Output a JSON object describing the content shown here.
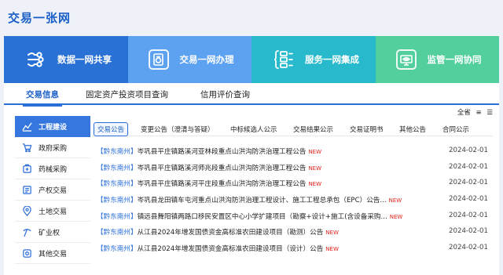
{
  "site": {
    "title": "交易一张网"
  },
  "tiles": [
    {
      "label": "数据一网共享",
      "icon": "data-share-icon",
      "color": "#2a71d6"
    },
    {
      "label": "交易一网办理",
      "icon": "document-icon",
      "color": "#5da2f0"
    },
    {
      "label": "服务一网集成",
      "icon": "integration-icon",
      "color": "#29b9cc"
    },
    {
      "label": "监管一网协同",
      "icon": "monitor-icon",
      "color": "#52cf9c"
    }
  ],
  "main_tabs": [
    "交易信息",
    "固定资产投资项目查询",
    "信用评价查询"
  ],
  "utils": {
    "all_province": "全省",
    "expand": "≡",
    "list": "☰"
  },
  "sidebar": [
    {
      "label": "工程建设",
      "icon": "chart-icon"
    },
    {
      "label": "政府采购",
      "icon": "cart-icon"
    },
    {
      "label": "药械采购",
      "icon": "medicine-icon"
    },
    {
      "label": "产权交易",
      "icon": "property-icon"
    },
    {
      "label": "土地交易",
      "icon": "location-icon"
    },
    {
      "label": "矿业权",
      "icon": "mining-icon"
    },
    {
      "label": "其他交易",
      "icon": "other-icon"
    }
  ],
  "subtabs": [
    "交易公告",
    "变更公告（澄清与答疑）",
    "中标候选人公示",
    "交易结果公示",
    "交易证明书",
    "其他公告",
    "合同公示"
  ],
  "notices": [
    {
      "region": "【黔东南州】",
      "title": "岑巩县平庄镇路溪河亚林段重点山洪沟防洪治理工程公告",
      "new": "NEW",
      "date": "2024-02-01"
    },
    {
      "region": "【黔东南州】",
      "title": "岑巩县平庄镇路溪河师兆段重点山洪沟防洪治理工程公告",
      "new": "NEW",
      "date": "2024-02-01"
    },
    {
      "region": "【黔东南州】",
      "title": "岑巩县平庄镇路溪河平庄段重点山洪沟防洪治理工程公告",
      "new": "NEW",
      "date": "2024-02-01"
    },
    {
      "region": "【黔东南州】",
      "title": "岑巩县龙田镇车屯河重点山洪沟防洪治理工程设计、施工工程总承包（EPC）公告...",
      "new": "NEW",
      "date": "2024-02-01"
    },
    {
      "region": "【黔东南州】",
      "title": "镇远县舞阳镇两路口移民安置区中心小学扩建项目（勘察+设计+施工(含设备采购...",
      "new": "NEW",
      "date": "2024-02-01"
    },
    {
      "region": "【黔东南州】",
      "title": "从江县2024年增发国债资金高标准农田建设项目（勘测）公告",
      "new": "NEW",
      "date": "2024-02-01"
    },
    {
      "region": "【黔东南州】",
      "title": "从江县2024年增发国债资金高标准农田建设项目（设计）公告",
      "new": "NEW",
      "date": "2024-02-01"
    }
  ]
}
